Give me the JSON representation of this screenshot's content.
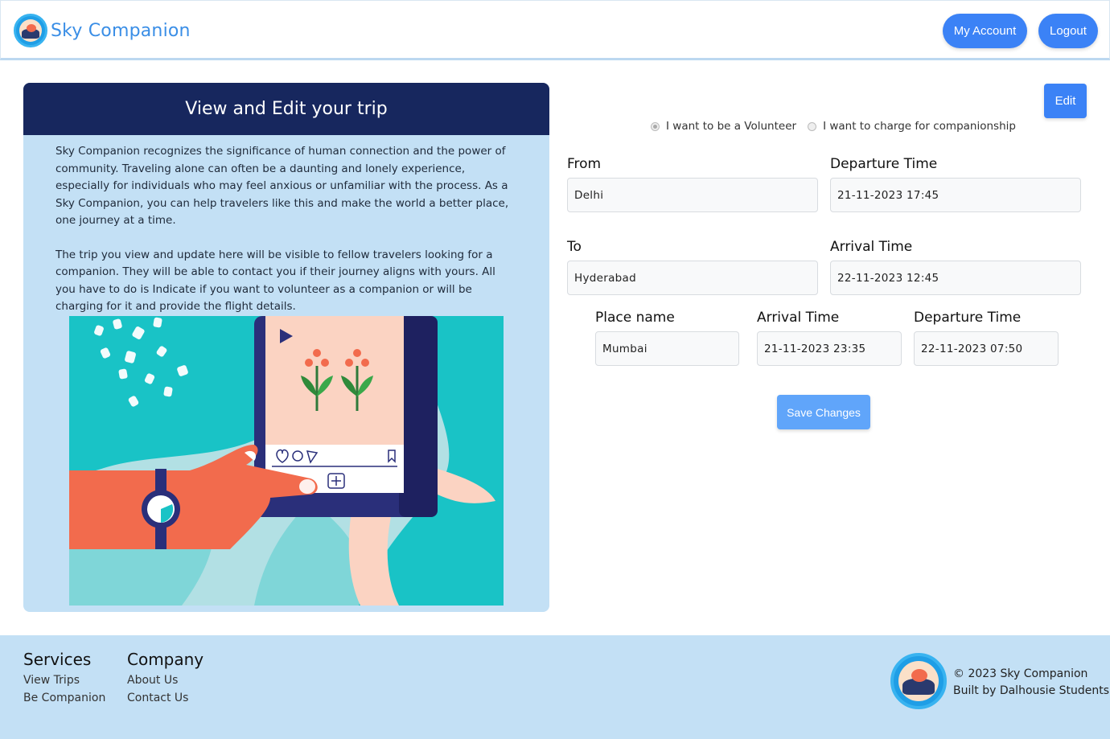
{
  "header": {
    "brand": "Sky Companion",
    "account_label": "My Account",
    "logout_label": "Logout"
  },
  "card": {
    "title": "View and Edit your trip",
    "para1": "Sky Companion recognizes the significance of human connection and the power of community. Traveling alone can often be a daunting and lonely experience, especially for individuals who may feel anxious or unfamiliar with the process. As a Sky Companion, you can help travelers like this and make the world a better place, one journey at a time.",
    "para2": "The trip you view and update here will be visible to fellow travelers looking for a companion. They will be able to contact you if their journey aligns with yours. All you have to do is Indicate if you want to volunteer as a companion or will be charging for it and provide the flight details."
  },
  "form": {
    "edit_label": "Edit",
    "radio_volunteer": "I want to be a Volunteer",
    "radio_charge": "I want to charge for companionship",
    "from_label": "From",
    "from_value": "Delhi",
    "departure_label": "Departure Time",
    "departure_value": "21-11-2023 17:45",
    "to_label": "To",
    "to_value": "Hyderabad",
    "arrival_label": "Arrival Time",
    "arrival_value": "22-11-2023 12:45",
    "stop": {
      "place_label": "Place name",
      "place_value": "Mumbai",
      "arrival_label": "Arrival Time",
      "arrival_value": "21-11-2023 23:35",
      "departure_label": "Departure Time",
      "departure_value": "22-11-2023 07:50"
    },
    "save_label": "Save Changes"
  },
  "footer": {
    "services_title": "Services",
    "services_links": [
      "View Trips",
      "Be Companion"
    ],
    "company_title": "Company",
    "company_links": [
      "About Us",
      "Contact Us"
    ],
    "copyright": "© 2023 Sky Companion",
    "built_by": "Built by Dalhousie Students"
  },
  "colors": {
    "primary": "#3b82f6",
    "card_header": "#17275e",
    "card_bg": "#c3e0f5"
  }
}
